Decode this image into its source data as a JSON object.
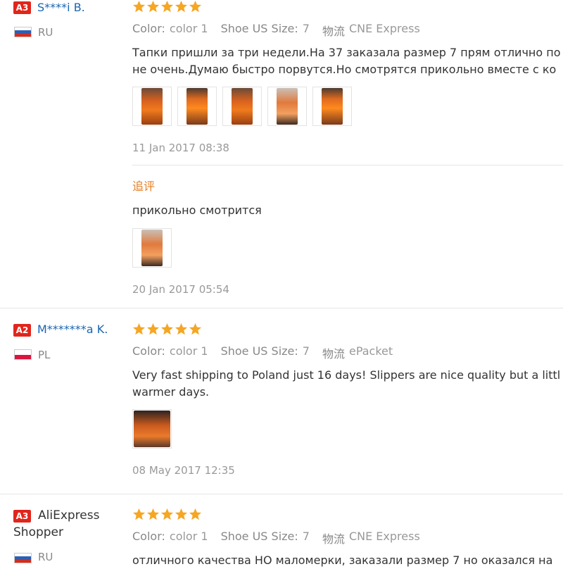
{
  "colors": {
    "badge": "#e1251b",
    "username_link": "#1865b3",
    "star": "#f5a623",
    "followup": "#e67e22",
    "muted": "#999999"
  },
  "reviews": [
    {
      "level": "A3",
      "name": "S****i B.",
      "country": "RU",
      "flag": "russia-flag-icon",
      "rating": 5,
      "color_label": "Color:",
      "color_value": "color 1",
      "size_label": "Shoe US Size:",
      "size_value": "7",
      "shipping_label": "物流",
      "shipping_value": "CNE Express",
      "text_line1": "Тапки пришли за три недели.На 37 заказала размер 7 прям отлично по",
      "text_line2": "не очень.Думаю быстро порвутся.Но смотрятся прикольно вместе с ко",
      "photos": 5,
      "date": "11 Jan 2017 08:38",
      "followup": {
        "label": "追评",
        "text": "прикольно смотрится",
        "photos": 1,
        "date": "20 Jan 2017 05:54"
      }
    },
    {
      "level": "A2",
      "name": "M*******a K.",
      "country": "PL",
      "flag": "poland-flag-icon",
      "rating": 5,
      "color_label": "Color:",
      "color_value": "color 1",
      "size_label": "Shoe US Size:",
      "size_value": "7",
      "shipping_label": "物流",
      "shipping_value": "ePacket",
      "text_line1": "Very fast shipping to Poland just 16 days! Slippers are nice quality but a littl",
      "text_line2": "warmer days.",
      "photos": 1,
      "date": "08 May 2017 12:35"
    },
    {
      "level": "A3",
      "name_line1": "AliExpress",
      "name_line2": "Shopper",
      "country": "RU",
      "flag": "russia-flag-icon",
      "rating": 5,
      "color_label": "Color:",
      "color_value": "color 1",
      "size_label": "Shoe US Size:",
      "size_value": "7",
      "shipping_label": "物流",
      "shipping_value": "CNE Express",
      "text_line1": "отличного качества НО маломерки, заказали размер 7 но оказался на"
    }
  ]
}
